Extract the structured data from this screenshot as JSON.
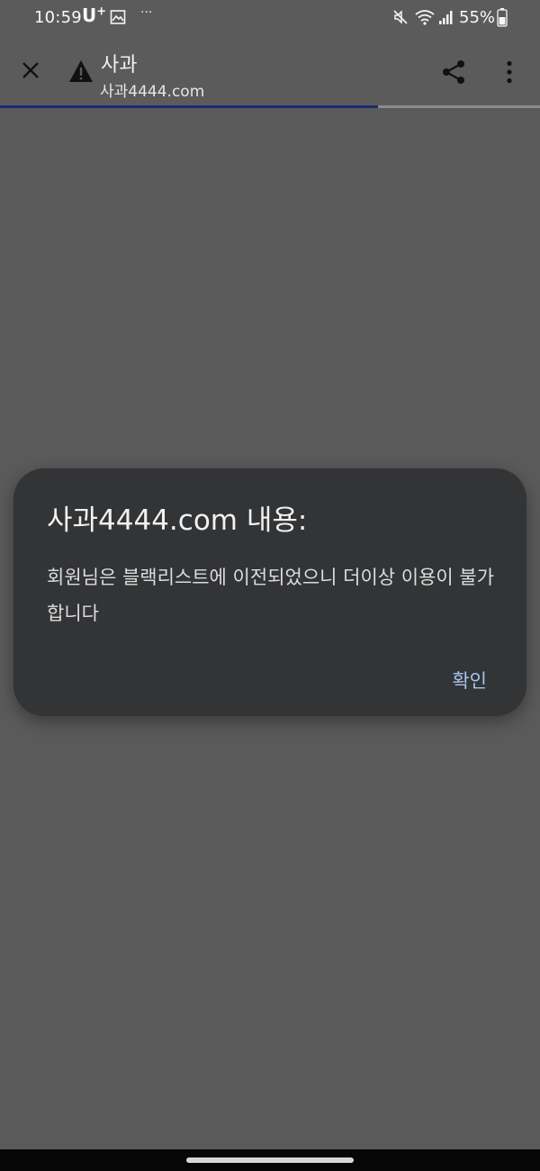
{
  "status_bar": {
    "time": "10:59",
    "carrier": "U",
    "carrier_sup": "+",
    "more": "···",
    "battery": "55%",
    "icons": [
      "gallery-icon",
      "mute-icon",
      "wifi-icon",
      "signal-icon",
      "battery-icon"
    ]
  },
  "toolbar": {
    "title": "사과",
    "url": "사과4444.com",
    "progress": 0.7,
    "icons": [
      "close-icon",
      "warning-icon",
      "share-icon",
      "more-vert-icon"
    ]
  },
  "dialog": {
    "title": "사과4444.com 내용:",
    "message": "회원님은 블랙리스트에 이전되었으니 더이상 이용이 불가합니다",
    "confirm_label": "확인"
  },
  "colors": {
    "background": "#5a5a5a",
    "dialog": "#333436",
    "accent": "#a8c4f2",
    "progress": "#1a2a6b"
  }
}
